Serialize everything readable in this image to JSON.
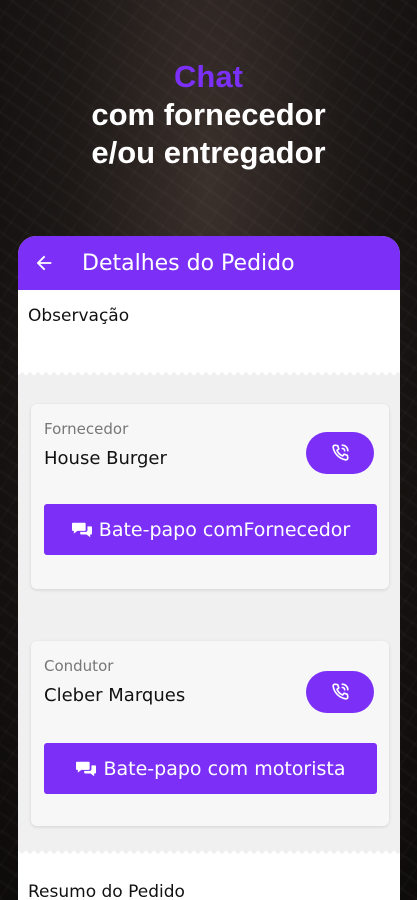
{
  "promo": {
    "accent": "Chat",
    "line1": "com fornecedor",
    "line2": "e/ou entregador"
  },
  "appbar": {
    "title": "Detalhes do Pedido",
    "back_icon": "arrow-left-icon"
  },
  "observation": {
    "title": "Observação"
  },
  "supplier": {
    "label": "Fornecedor",
    "name": "House Burger",
    "call_icon": "phone-icon",
    "chat_label": "Bate-papo comFornecedor",
    "chat_icon": "chat-icon"
  },
  "driver": {
    "label": "Condutor",
    "name": "Cleber Marques",
    "call_icon": "phone-icon",
    "chat_label": "Bate-papo com motorista",
    "chat_icon": "chat-icon"
  },
  "summary": {
    "title": "Resumo do Pedido"
  },
  "colors": {
    "accent": "#7b2ff7",
    "background": "#1e1917"
  }
}
